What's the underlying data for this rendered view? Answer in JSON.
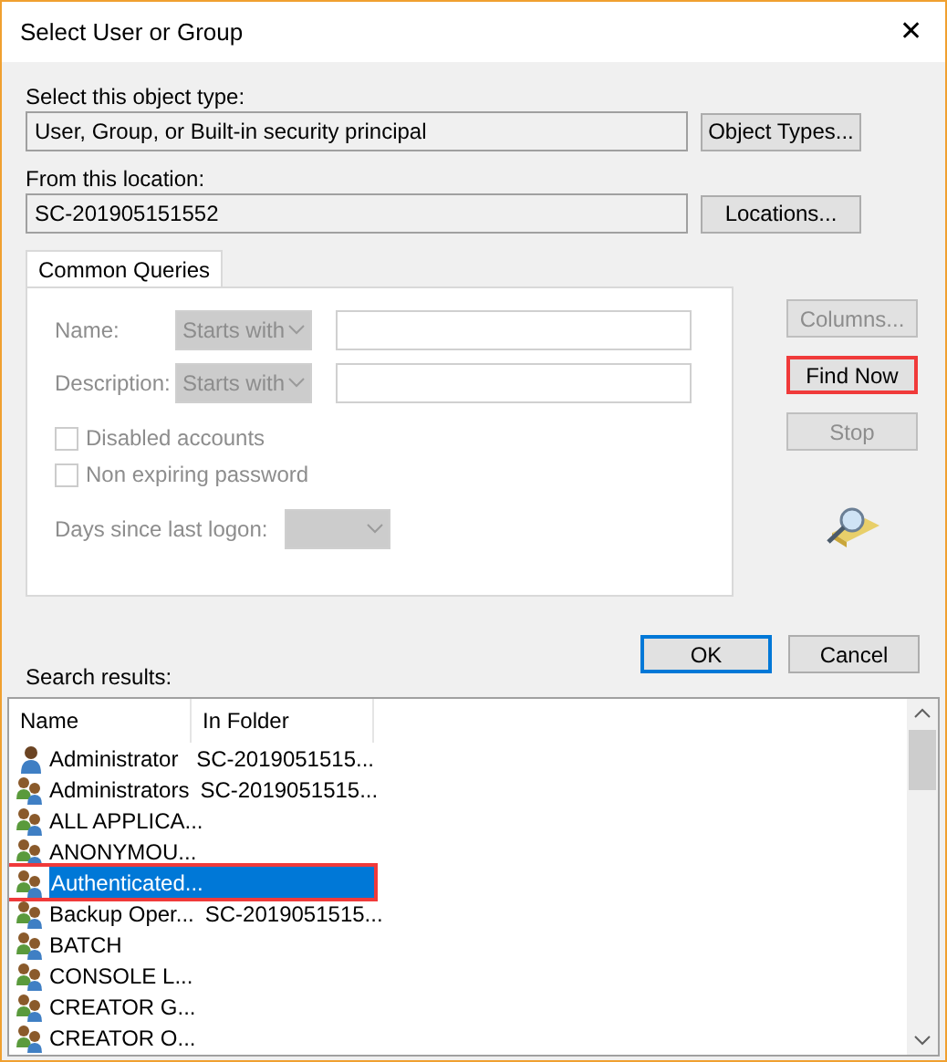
{
  "window": {
    "title": "Select User or Group",
    "close": "✕"
  },
  "object_type": {
    "label": "Select this object type:",
    "value": "User, Group, or Built-in security principal",
    "button": "Object Types..."
  },
  "location": {
    "label": "From this location:",
    "value": "SC-201905151552",
    "button": "Locations..."
  },
  "tab": {
    "label": "Common Queries",
    "selected": true
  },
  "queries": {
    "disabled": true,
    "fields": [
      {
        "label": "Name:",
        "mode": "Starts with"
      },
      {
        "label": "Description:",
        "mode": "Starts with"
      }
    ],
    "checkboxes": [
      {
        "label": "Disabled accounts",
        "checked": false
      },
      {
        "label": "Non expiring password",
        "checked": false
      }
    ],
    "days_label": "Days since last logon:"
  },
  "side_buttons": [
    {
      "label": "Columns...",
      "disabled": true,
      "highlighted": false
    },
    {
      "label": "Find Now",
      "disabled": false,
      "highlighted": true
    },
    {
      "label": "Stop",
      "disabled": true,
      "highlighted": false
    }
  ],
  "dialog_buttons": [
    {
      "label": "OK",
      "default": true
    },
    {
      "label": "Cancel",
      "default": false
    }
  ],
  "results_label": "Search results:",
  "columns": [
    "Name",
    "In Folder"
  ],
  "rows": [
    {
      "kind": "user",
      "name": "Administrator",
      "folder": "SC-2019051515...",
      "selected": false,
      "highlighted": false
    },
    {
      "kind": "group",
      "name": "Administrators",
      "folder": "SC-2019051515...",
      "selected": false,
      "highlighted": false
    },
    {
      "kind": "group",
      "name": "ALL APPLICA...",
      "selected": false,
      "highlighted": false
    },
    {
      "kind": "group",
      "name": "ANONYMOU...",
      "selected": false,
      "highlighted": false
    },
    {
      "kind": "group",
      "name": "Authenticated...",
      "selected": true,
      "highlighted": true
    },
    {
      "kind": "group",
      "name": "Backup Oper...",
      "folder": "SC-2019051515...",
      "selected": false,
      "highlighted": false
    },
    {
      "kind": "group",
      "name": "BATCH",
      "selected": false,
      "highlighted": false
    },
    {
      "kind": "group",
      "name": "CONSOLE L...",
      "selected": false,
      "highlighted": false
    },
    {
      "kind": "group",
      "name": "CREATOR G...",
      "selected": false,
      "highlighted": false
    },
    {
      "kind": "group",
      "name": "CREATOR O...",
      "selected": false,
      "highlighted": false
    }
  ]
}
